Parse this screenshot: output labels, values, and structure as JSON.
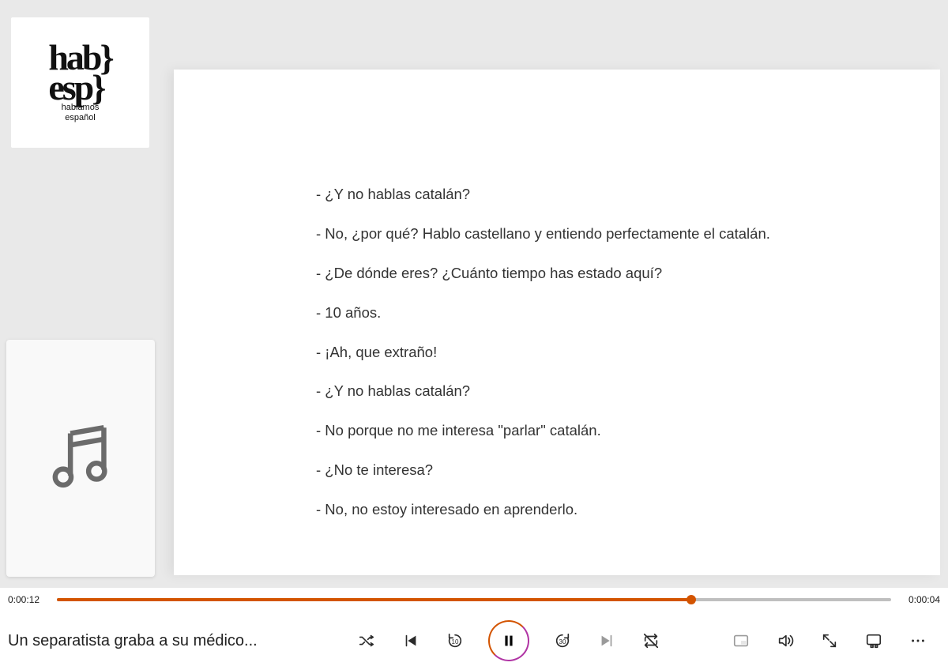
{
  "logo": {
    "line1": "hab}",
    "line2": "esp}",
    "sub1": "hablamos",
    "sub2": "español"
  },
  "transcript": [
    "- ¿Y no hablas catalán?",
    "- No, ¿por qué? Hablo castellano y entiendo perfectamente el catalán.",
    "- ¿De dónde eres? ¿Cuánto tiempo has estado aquí?",
    "- 10 años.",
    "- ¡Ah, que extraño!",
    "- ¿Y no hablas catalán?",
    "- No porque no me interesa \"parlar\" catalán.",
    "- ¿No te interesa?",
    "- No, no estoy interesado en aprenderlo."
  ],
  "player": {
    "elapsed": "0:00:12",
    "remaining": "0:00:04",
    "progress_percent": 76,
    "track_title": "Un separatista graba a su médico...",
    "skip_back_seconds": "10",
    "skip_forward_seconds": "30"
  },
  "colors": {
    "accent": "#d35400"
  }
}
